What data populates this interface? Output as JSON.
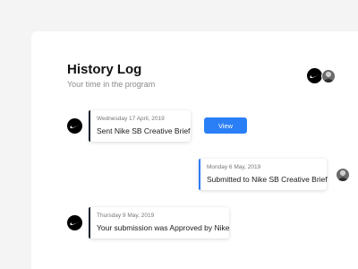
{
  "header": {
    "title": "History Log",
    "subtitle": "Your time in the program"
  },
  "colors": {
    "accent": "#2b7ff6",
    "dark_bar": "#1f2430",
    "background": "#f4f4f5"
  },
  "history": [
    {
      "date": "Wednesday 17 April, 2019",
      "text": "Sent Nike SB Creative Brief",
      "author": "nike",
      "action_label": "View"
    },
    {
      "date": "Monday 6 May, 2019",
      "text": "Submitted to Nike SB Creative Brief",
      "author": "user"
    },
    {
      "date": "Thursday 9 May, 2019",
      "text": "Your submission was Approved by Nike",
      "author": "nike"
    }
  ]
}
